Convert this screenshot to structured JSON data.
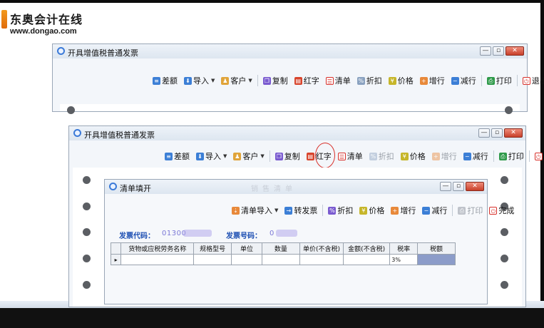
{
  "brand": {
    "name_cn": "东奥会计在线",
    "url": "www.dongao.com"
  },
  "back_window": {
    "title": "开具增值税普通发票",
    "toolbar": [
      "差额",
      "导入",
      "客户",
      "复制",
      "红字",
      "清单",
      "折扣",
      "价格",
      "增行",
      "减行",
      "打印",
      "退出"
    ]
  },
  "front_window": {
    "title": "开具增值税普通发票",
    "toolbar": [
      "差额",
      "导入",
      "客户",
      "复制",
      "红字",
      "清单",
      "折扣",
      "价格",
      "增行",
      "减行",
      "打印",
      "退出"
    ],
    "watermark": "清单填开"
  },
  "dialog": {
    "title": "清单填开",
    "watermark": "销售清单",
    "toolbar": [
      "清单导入",
      "转发票",
      "折扣",
      "价格",
      "增行",
      "减行",
      "打印",
      "完成"
    ],
    "invoice_code_label": "发票代码：",
    "invoice_code_value": "01300",
    "invoice_no_label": "发票号码：",
    "invoice_no_value": "0",
    "table": {
      "headers": [
        "货物或应税劳务名称",
        "规格型号",
        "单位",
        "数量",
        "单价(不含税)",
        "金额(不含税)",
        "税率",
        "税额"
      ],
      "rows": [
        [
          "",
          "",
          "",
          "",
          "",
          "",
          "3%",
          ""
        ]
      ]
    }
  },
  "colors": {
    "accent_blue": "#1d4fb3",
    "highlight_red": "#d8302a",
    "brand_orange": "#f08a1c"
  }
}
